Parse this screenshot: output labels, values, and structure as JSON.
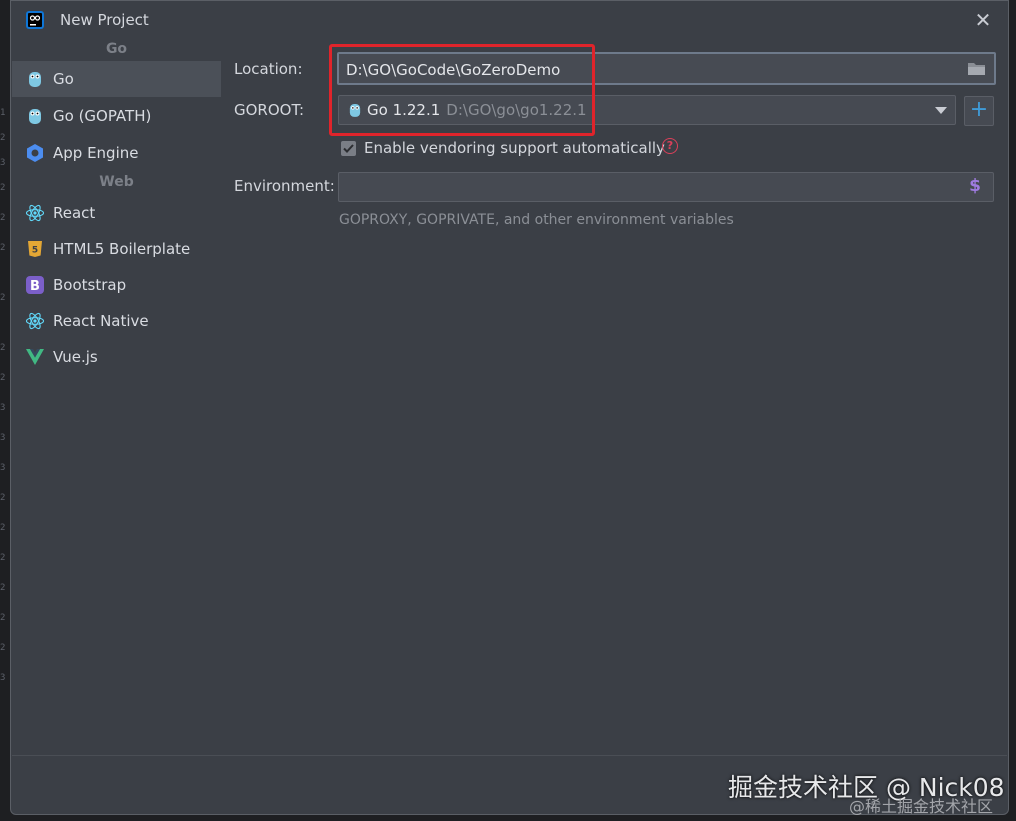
{
  "window": {
    "title": "New Project"
  },
  "sidebar": {
    "groups": [
      {
        "header": "Go",
        "items": [
          {
            "label": "Go",
            "icon": "gopher-icon"
          },
          {
            "label": "Go (GOPATH)",
            "icon": "gopher-icon"
          },
          {
            "label": "App Engine",
            "icon": "app-engine-icon"
          }
        ]
      },
      {
        "header": "Web",
        "items": [
          {
            "label": "React",
            "icon": "react-icon"
          },
          {
            "label": "HTML5 Boilerplate",
            "icon": "html5-icon"
          },
          {
            "label": "Bootstrap",
            "icon": "bootstrap-icon"
          },
          {
            "label": "React Native",
            "icon": "react-icon"
          },
          {
            "label": "Vue.js",
            "icon": "vue-icon"
          }
        ]
      }
    ],
    "selected": "Go"
  },
  "form": {
    "location_label": "Location:",
    "location_value": "D:\\GO\\GoCode\\GoZeroDemo",
    "goroot_label": "GOROOT:",
    "goroot_version": "Go 1.22.1",
    "goroot_path": "D:\\GO\\go\\go1.22.1",
    "vendoring_label": "Enable vendoring support automatically",
    "vendoring_checked": true,
    "environment_label": "Environment:",
    "environment_value": "",
    "environment_hint": "GOPROXY, GOPRIVATE, and other environment variables",
    "help_symbol": "?",
    "env_symbol": "$",
    "add_symbol": "+"
  },
  "watermark": {
    "main": "掘金技术社区 @ Nick08",
    "sub": "@稀土掘金技术社区"
  },
  "colors": {
    "dialog_bg": "#3b3f46",
    "selected_bg": "#4b5058",
    "highlight_box": "#e0242b",
    "accent_blue": "#3f9bd8",
    "help_red": "#d9405a"
  }
}
